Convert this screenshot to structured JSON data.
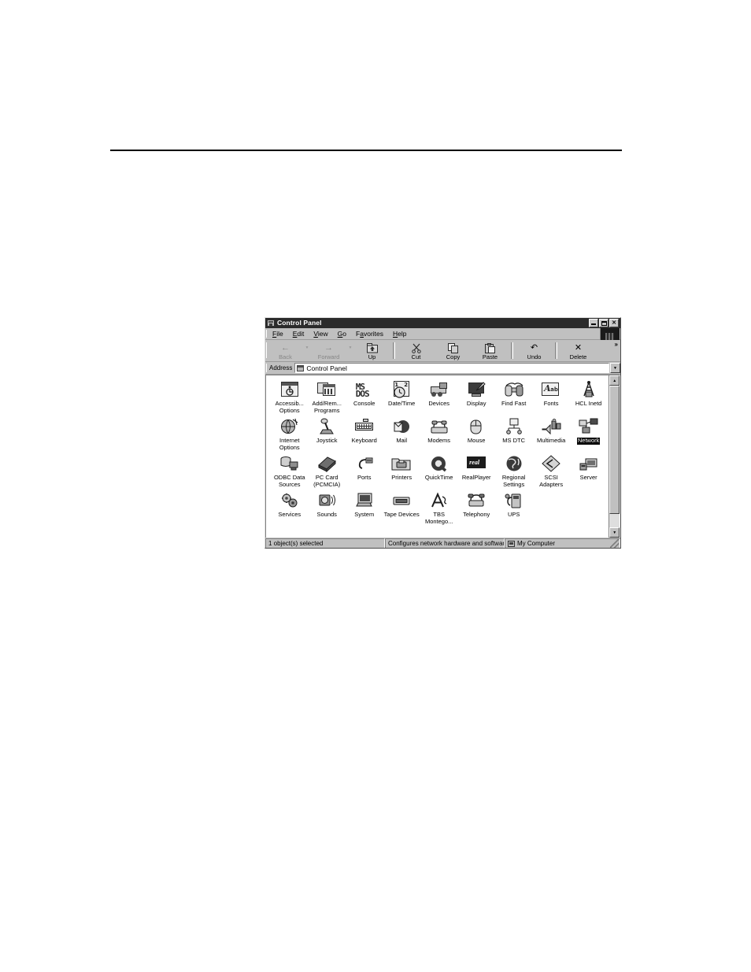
{
  "page": {
    "background": "#ffffff",
    "rule_color": "#000000"
  },
  "window": {
    "title": "Control Panel",
    "title_icon": "control-panel-icon",
    "controls": {
      "minimize": "_",
      "maximize": "□",
      "close": "✕"
    },
    "menu": [
      {
        "label": "File",
        "accel": "F"
      },
      {
        "label": "Edit",
        "accel": "E"
      },
      {
        "label": "View",
        "accel": "V"
      },
      {
        "label": "Go",
        "accel": "G"
      },
      {
        "label": "Favorites",
        "accel": "a"
      },
      {
        "label": "Help",
        "accel": "H"
      }
    ],
    "toolbar": {
      "buttons": [
        {
          "label": "Back",
          "icon": "back-arrow-icon",
          "glyph": "←",
          "disabled": true,
          "dropdown": true
        },
        {
          "label": "Forward",
          "icon": "forward-arrow-icon",
          "glyph": "→",
          "disabled": true,
          "dropdown": true
        },
        {
          "label": "Up",
          "icon": "up-folder-icon",
          "glyph": "↱",
          "disabled": false,
          "dropdown": false
        },
        {
          "label": "Cut",
          "icon": "scissors-icon",
          "glyph": "✂",
          "disabled": false,
          "dropdown": false
        },
        {
          "label": "Copy",
          "icon": "copy-icon",
          "glyph": "⧉",
          "disabled": false,
          "dropdown": false
        },
        {
          "label": "Paste",
          "icon": "clipboard-icon",
          "glyph": "Ὄb",
          "disabled": false,
          "dropdown": false
        },
        {
          "label": "Undo",
          "icon": "undo-arrow-icon",
          "glyph": "↶",
          "disabled": false,
          "dropdown": false
        },
        {
          "label": "Delete",
          "icon": "delete-x-icon",
          "glyph": "✕",
          "disabled": false,
          "dropdown": false
        }
      ],
      "overflow_chevron": "»"
    },
    "address": {
      "label": "Address",
      "icon": "control-panel-icon",
      "value": "Control Panel",
      "dropdown_arrow": "▼"
    },
    "scrollbar": {
      "up_arrow": "▲",
      "down_arrow": "▼"
    },
    "status": {
      "selection": "1 object(s) selected",
      "description": "Configures network hardware and software",
      "location": "My Computer",
      "location_icon": "my-computer-icon"
    }
  },
  "icons": {
    "rows": [
      [
        {
          "label": "Accessib... Options",
          "art": "accessibility",
          "selected": false
        },
        {
          "label": "Add/Rem... Programs",
          "art": "addremove",
          "selected": false
        },
        {
          "label": "Console",
          "art": "console",
          "selected": false
        },
        {
          "label": "Date/Time",
          "art": "datetime",
          "selected": false
        },
        {
          "label": "Devices",
          "art": "devices",
          "selected": false
        },
        {
          "label": "Display",
          "art": "display",
          "selected": false
        },
        {
          "label": "Find Fast",
          "art": "findfast",
          "selected": false
        },
        {
          "label": "Fonts",
          "art": "fonts",
          "selected": false
        },
        {
          "label": "HCL Inetd",
          "art": "hclinetd",
          "selected": false
        }
      ],
      [
        {
          "label": "Internet Options",
          "art": "internet",
          "selected": false
        },
        {
          "label": "Joystick",
          "art": "joystick",
          "selected": false
        },
        {
          "label": "Keyboard",
          "art": "keyboard",
          "selected": false
        },
        {
          "label": "Mail",
          "art": "mail",
          "selected": false
        },
        {
          "label": "Modems",
          "art": "modems",
          "selected": false
        },
        {
          "label": "Mouse",
          "art": "mouse",
          "selected": false
        },
        {
          "label": "MS DTC",
          "art": "msdtc",
          "selected": false
        },
        {
          "label": "Multimedia",
          "art": "multimedia",
          "selected": false
        },
        {
          "label": "Network",
          "art": "network",
          "selected": true
        }
      ],
      [
        {
          "label": "ODBC Data Sources",
          "art": "odbc",
          "selected": false
        },
        {
          "label": "PC Card (PCMCIA)",
          "art": "pccard",
          "selected": false
        },
        {
          "label": "Ports",
          "art": "ports",
          "selected": false
        },
        {
          "label": "Printers",
          "art": "printers",
          "selected": false
        },
        {
          "label": "QuickTime",
          "art": "quicktime",
          "selected": false
        },
        {
          "label": "RealPlayer",
          "art": "realplayer",
          "selected": false
        },
        {
          "label": "Regional Settings",
          "art": "regional",
          "selected": false
        },
        {
          "label": "SCSI Adapters",
          "art": "scsi",
          "selected": false
        },
        {
          "label": "Server",
          "art": "server",
          "selected": false
        }
      ],
      [
        {
          "label": "Services",
          "art": "services",
          "selected": false
        },
        {
          "label": "Sounds",
          "art": "sounds",
          "selected": false
        },
        {
          "label": "System",
          "art": "system",
          "selected": false
        },
        {
          "label": "Tape Devices",
          "art": "tape",
          "selected": false
        },
        {
          "label": "TBS Montego...",
          "art": "tbs",
          "selected": false
        },
        {
          "label": "Telephony",
          "art": "telephony",
          "selected": false
        },
        {
          "label": "UPS",
          "art": "ups",
          "selected": false
        }
      ]
    ]
  }
}
